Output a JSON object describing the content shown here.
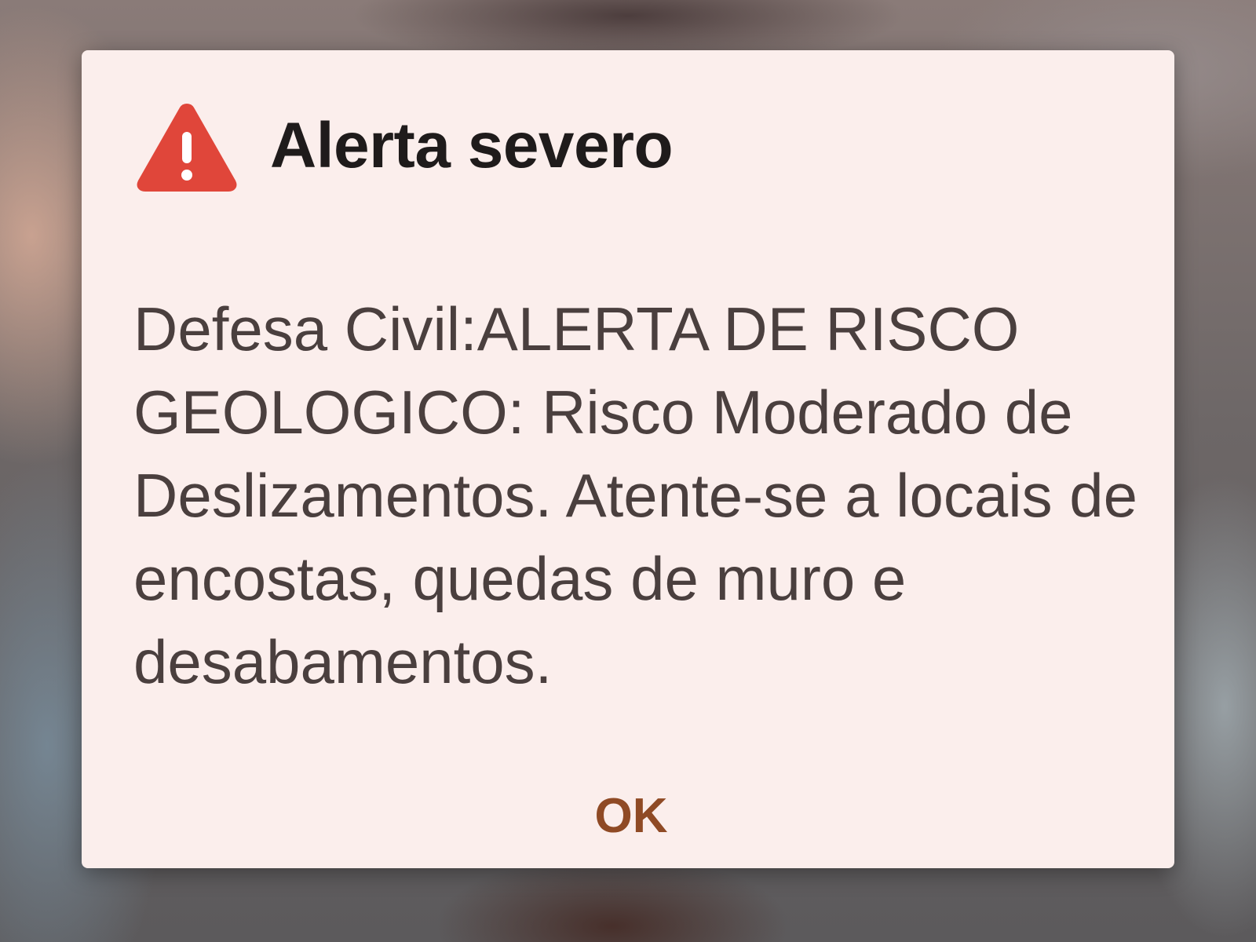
{
  "dialog": {
    "icon": "warning-triangle-icon",
    "icon_color": "#e0463a",
    "title": "Alerta severo",
    "message": "Defesa Civil:ALERTA DE RISCO GEOLOGICO: Risco Moderado de Deslizamentos. Atente-se a locais de encostas, quedas de muro e desabamentos.",
    "ok_label": "OK",
    "background_color": "#fbeeec",
    "button_color": "#8f4a25"
  }
}
